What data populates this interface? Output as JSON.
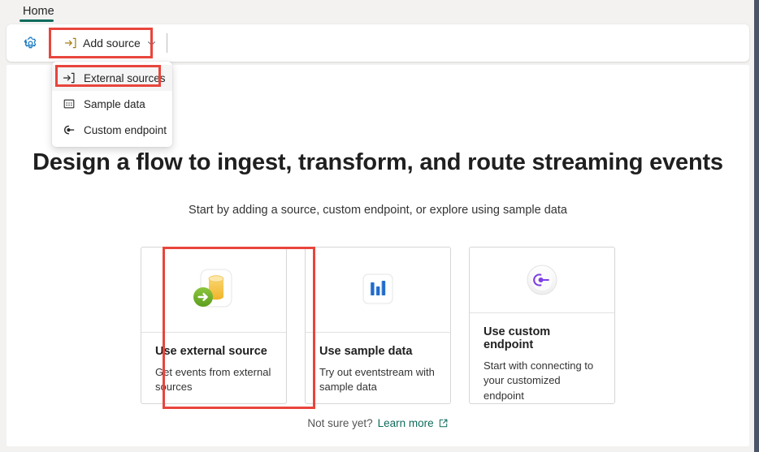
{
  "window": {
    "accent_teal": "#0f6b5c",
    "annotation_red": "#e8453c",
    "canvas_bg": "#ffffff",
    "chrome_bg": "#f3f2f1"
  },
  "tabs": [
    {
      "label": "Home",
      "selected": true
    }
  ],
  "toolbar": {
    "settings_icon": "gear-icon",
    "add_source": {
      "label": "Add source",
      "icon": "arrow-into-bracket-icon",
      "chevron": "chevron-down-icon",
      "expanded": true,
      "highlighted": true
    }
  },
  "menu": {
    "open": true,
    "items": [
      {
        "label": "External sources",
        "icon": "arrow-into-bracket-icon",
        "highlighted": true
      },
      {
        "label": "Sample data",
        "icon": "dotted-square-icon",
        "highlighted": false
      },
      {
        "label": "Custom endpoint",
        "icon": "endpoint-icon",
        "highlighted": false
      }
    ]
  },
  "empty_state": {
    "headline": "Design a flow to ingest, transform, and route streaming events",
    "subheadline": "Start by adding a source, custom endpoint, or explore using sample data",
    "cards": [
      {
        "title": "Use external source",
        "description": "Get events from external sources",
        "icon": "database-with-green-arrow-icon",
        "highlighted": true
      },
      {
        "title": "Use sample data",
        "description": "Try out eventstream with sample data",
        "icon": "bar-chart-icon",
        "highlighted": false
      },
      {
        "title": "Use custom endpoint",
        "description": "Start with connecting to your customized endpoint",
        "icon": "custom-endpoint-icon",
        "highlighted": false
      }
    ],
    "footer": {
      "prompt": "Not sure yet?",
      "link_label": "Learn more",
      "link_icon": "external-link-icon"
    }
  }
}
